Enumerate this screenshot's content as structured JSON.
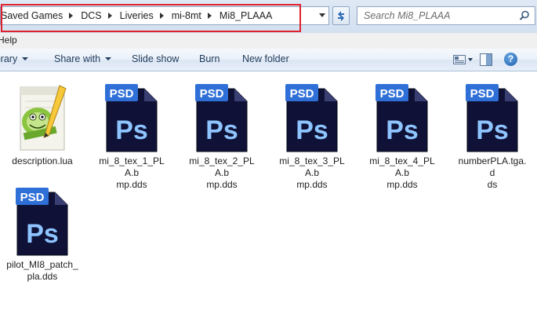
{
  "address": {
    "crumbs": [
      "Saved Games",
      "DCS",
      "Liveries",
      "mi-8mt",
      "Mi8_PLAAA"
    ]
  },
  "search": {
    "placeholder": "Search Mi8_PLAAA"
  },
  "menubar": {
    "help": "Help"
  },
  "toolbar": {
    "library": "Library",
    "share_with": "Share with",
    "slide_show": "Slide show",
    "burn": "Burn",
    "new_folder": "New folder"
  },
  "files": [
    {
      "line1": "description.lua",
      "line2": "",
      "icon": "notepad-plus-plus-icon"
    },
    {
      "line1": "mi_8_tex_1_PLA.b",
      "line2": "mp.dds",
      "icon": "psd-icon"
    },
    {
      "line1": "mi_8_tex_2_PLA.b",
      "line2": "mp.dds",
      "icon": "psd-icon"
    },
    {
      "line1": "mi_8_tex_3_PLA.b",
      "line2": "mp.dds",
      "icon": "psd-icon"
    },
    {
      "line1": "mi_8_tex_4_PLA.b",
      "line2": "mp.dds",
      "icon": "psd-icon"
    },
    {
      "line1": "numberPLA.tga.d",
      "line2": "ds",
      "icon": "psd-icon"
    },
    {
      "line1": "pilot_MI8_patch_",
      "line2": "pla.dds",
      "icon": "psd-icon"
    }
  ],
  "psd_icon": {
    "top_text": "PSD",
    "main_text": "Ps"
  },
  "colors": {
    "psd_dark": "#0f1236",
    "psd_accent": "#2f6fd8",
    "highlight": "#e0212b"
  }
}
